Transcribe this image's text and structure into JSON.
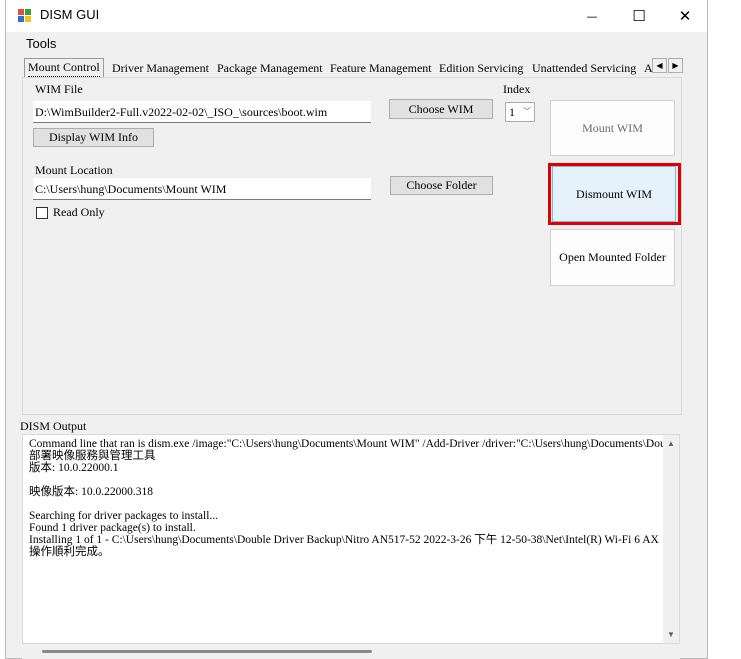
{
  "window": {
    "title": "DISM GUI",
    "minimize_glyph": "—",
    "maximize_glyph": "☐",
    "close_glyph": "✕"
  },
  "menu": {
    "tools": "Tools"
  },
  "tabs": [
    {
      "label": "Mount Control",
      "active": true
    },
    {
      "label": "Driver Management"
    },
    {
      "label": "Package Management"
    },
    {
      "label": "Feature Management"
    },
    {
      "label": "Edition Servicing"
    },
    {
      "label": "Unattended Servicing"
    },
    {
      "label": "A"
    }
  ],
  "tab_scroll": {
    "left": "◀",
    "right": "▶"
  },
  "mount_control": {
    "wim_file_label": "WIM File",
    "wim_file_value": "D:\\WimBuilder2-Full.v2022-02-02\\_ISO_\\sources\\boot.wim",
    "choose_wim": "Choose WIM",
    "index_label": "Index",
    "index_value": "1",
    "display_wim_info": "Display WIM Info",
    "mount_location_label": "Mount Location",
    "mount_location_value": "C:\\Users\\hung\\Documents\\Mount WIM",
    "choose_folder": "Choose Folder",
    "read_only": "Read Only",
    "mount_wim": "Mount WIM",
    "dismount_wim": "Dismount WIM",
    "open_mounted_folder": "Open Mounted Folder"
  },
  "highlight_color": "#e00000",
  "output": {
    "label": "DISM Output",
    "lines": [
      "Command line that ran is dism.exe /image:\"C:\\Users\\hung\\Documents\\Mount WIM\" /Add-Driver /driver:\"C:\\Users\\hung\\Documents\\Dou",
      "部署映像服務與管理工具",
      "版本: 10.0.22000.1",
      "",
      "映像版本: 10.0.22000.318",
      "",
      "Searching for driver packages to install...",
      "Found 1 driver package(s) to install.",
      "Installing 1 of 1 - C:\\Users\\hung\\Documents\\Double Driver Backup\\Nitro AN517-52 2022-3-26 下午 12-50-38\\Net\\Intel(R) Wi-Fi 6 AX",
      "操作順利完成。"
    ]
  }
}
